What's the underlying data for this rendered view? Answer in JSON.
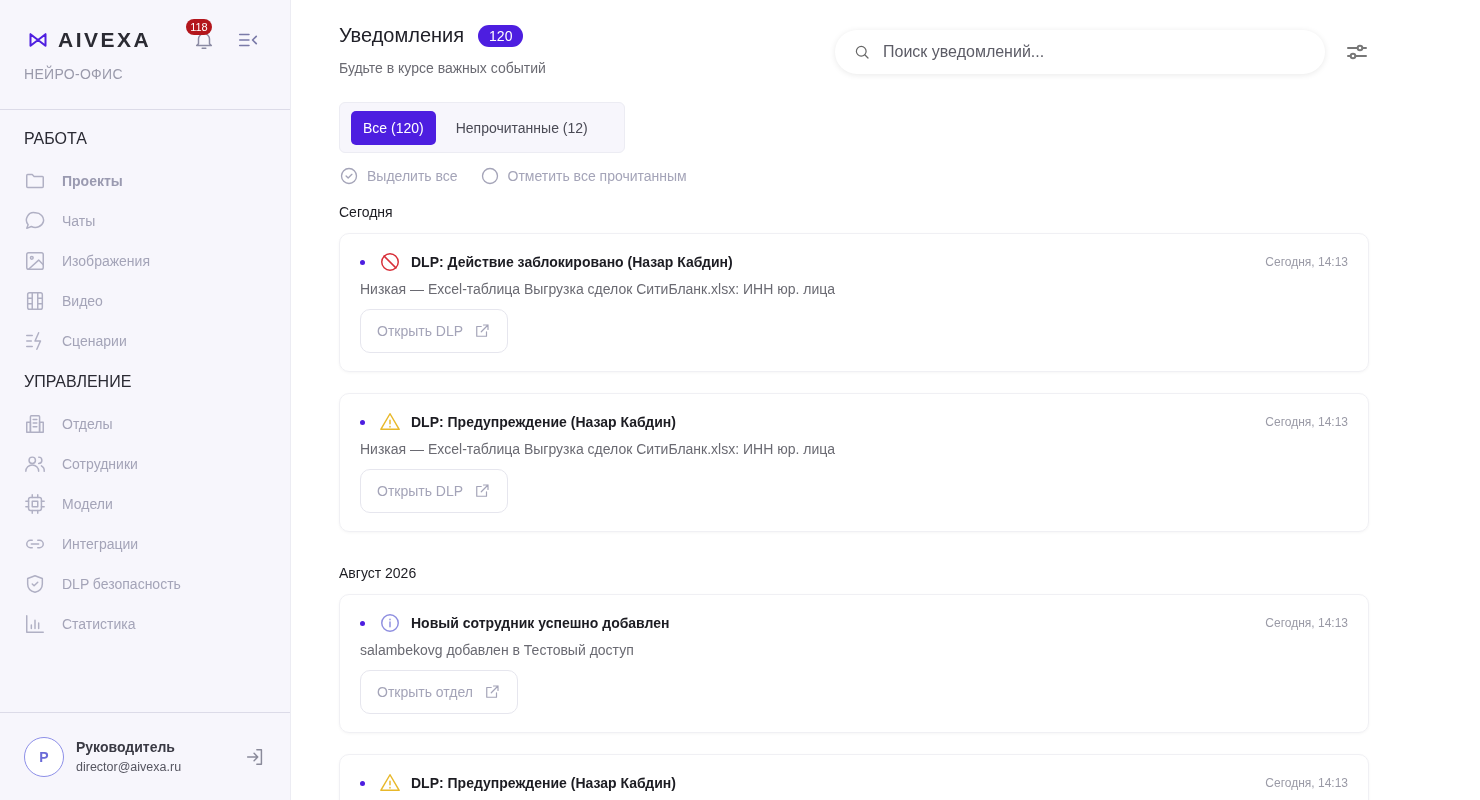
{
  "sidebar": {
    "logo": "AIVEXA",
    "subtitle": "НЕЙРО-ОФИС",
    "bell_badge": "118",
    "sections": [
      {
        "title": "РАБОТА",
        "items": [
          {
            "label": "Проекты",
            "selected": true
          },
          {
            "label": "Чаты",
            "selected": false
          },
          {
            "label": "Изображения",
            "selected": false
          },
          {
            "label": "Видео",
            "selected": false
          },
          {
            "label": "Сценарии",
            "selected": false
          }
        ]
      },
      {
        "title": "УПРАВЛЕНИЕ",
        "items": [
          {
            "label": "Отделы",
            "selected": false
          },
          {
            "label": "Сотрудники",
            "selected": false
          },
          {
            "label": "Модели",
            "selected": false
          },
          {
            "label": "Интеграции",
            "selected": false
          },
          {
            "label": "DLP безопасность",
            "selected": false
          },
          {
            "label": "Статистика",
            "selected": false
          }
        ]
      }
    ],
    "user": {
      "initial": "Р",
      "name": "Руководитель",
      "email": "director@aivexa.ru"
    }
  },
  "header": {
    "title": "Уведомления",
    "count": "120",
    "subtitle": "Будьте в курсе важных событий",
    "search": {
      "placeholder": "Поиск уведомлений..."
    }
  },
  "tabs": [
    {
      "label": "Все (120)",
      "selected": true
    },
    {
      "label": "Непрочитанные (12)",
      "selected": false
    }
  ],
  "actions": [
    {
      "label": "Выделить все"
    },
    {
      "label": "Отметить все прочитанным"
    }
  ],
  "groups": [
    {
      "title": "Сегодня",
      "notifications": [
        {
          "unread": true,
          "kind": "blocked",
          "title": "DLP: Действие заблокировано (Назар Кабдин)",
          "time": "Сегодня, 14:13",
          "text": "Низкая — Excel-таблица Выгрузка сделок СитиБланк.xlsx: ИНН юр. лица",
          "button": "Открыть DLP"
        },
        {
          "unread": true,
          "kind": "warning",
          "title": "DLP: Предупреждение (Назар Кабдин)",
          "time": "Сегодня, 14:13",
          "text": "Низкая — Excel-таблица Выгрузка сделок СитиБланк.xlsx: ИНН юр. лица",
          "button": "Открыть DLP"
        }
      ]
    },
    {
      "title": "Август 2026",
      "notifications": [
        {
          "unread": true,
          "kind": "info",
          "title": "Новый сотрудник успешно добавлен",
          "time": "Сегодня, 14:13",
          "text": "salambekovg добавлен в Тестовый доступ",
          "button": "Открыть отдел"
        },
        {
          "unread": true,
          "kind": "warning",
          "title": "DLP: Предупреждение (Назар Кабдин)",
          "time": "Сегодня, 14:13"
        }
      ]
    }
  ]
}
